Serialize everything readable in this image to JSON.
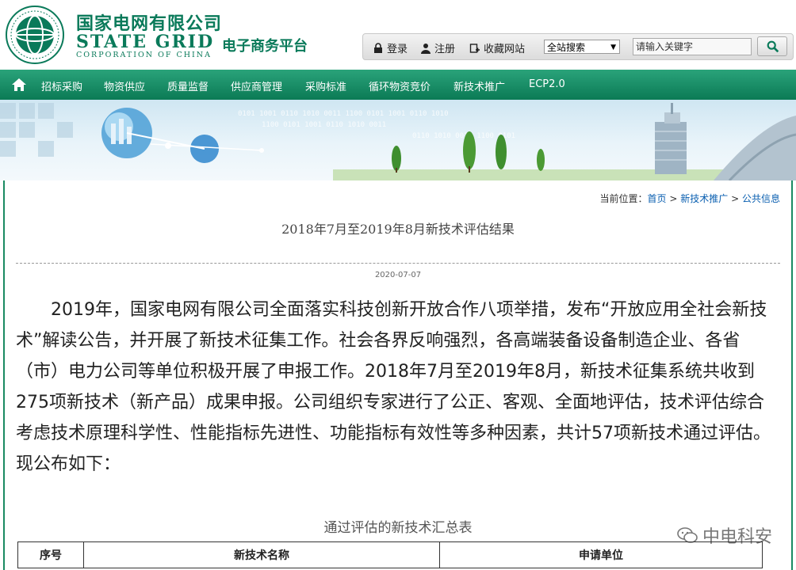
{
  "header": {
    "logo_cn": "国家电网有限公司",
    "logo_en": "STATE GRID",
    "logo_en_sub": "CORPORATION OF CHINA",
    "logo_seal_text": "STATE GRID CORPORATION OF CHINA",
    "platform": "电子商务平台",
    "brand_color": "#0a7a5a"
  },
  "topbar": {
    "login": "登录",
    "register": "注册",
    "bookmark": "收藏网站",
    "search_scope": "全站搜索",
    "search_placeholder": "请输入关键字"
  },
  "nav": {
    "items": [
      "招标采购",
      "物资供应",
      "质量监督",
      "供应商管理",
      "采购标准",
      "循环物资竞价",
      "新技术推广",
      "ECP2.0"
    ]
  },
  "breadcrumb": {
    "prefix": "当前位置：",
    "items": [
      "首页",
      "新技术推广",
      "公共信息"
    ],
    "sep": ">"
  },
  "article": {
    "title": "2018年7月至2019年8月新技术评估结果",
    "date": "2020-07-07",
    "body": "2019年，国家电网有限公司全面落实科技创新开放合作八项举措，发布“开放应用全社会新技术”解读公告，并开展了新技术征集工作。社会各界反响强烈，各高端装备设备制造企业、各省（市）电力公司等单位积极开展了申报工作。2018年7月至2019年8月，新技术征集系统共收到275项新技术（新产品）成果申报。公司组织专家进行了公正、客观、全面地评估，技术评估综合考虑技术原理科学性、性能指标先进性、功能指标有效性等多种因素，共计57项新技术通过评估。现公布如下："
  },
  "table": {
    "caption": "通过评估的新技术汇总表",
    "headers": [
      "序号",
      "新技术名称",
      "申请单位"
    ]
  },
  "watermark": {
    "text": "中电科安"
  }
}
